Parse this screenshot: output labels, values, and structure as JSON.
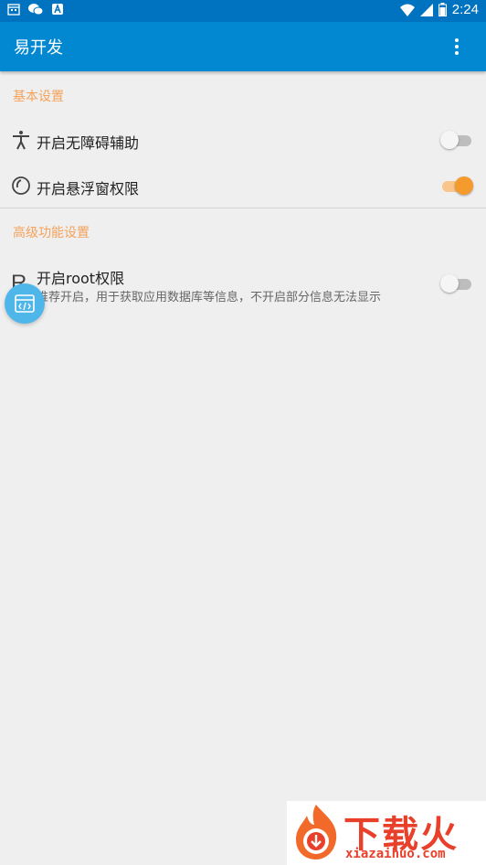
{
  "status_bar": {
    "time": "2:24",
    "left_icons": [
      "calendar-icon",
      "wechat-icon",
      "notification-a-icon"
    ],
    "right_icons": [
      "wifi-icon",
      "signal-icon",
      "battery-icon"
    ]
  },
  "app_bar": {
    "title": "易开发",
    "menu_icon": "more-vert-icon"
  },
  "sections": [
    {
      "header": "基本设置",
      "items": [
        {
          "title": "开启无障碍辅助",
          "icon": "accessibility-icon",
          "enabled": false
        },
        {
          "title": "开启悬浮窗权限",
          "icon": "floating-window-icon",
          "enabled": true
        }
      ]
    },
    {
      "header": "高级功能设置",
      "items": [
        {
          "title": "开启root权限",
          "subtitle": "推荐开启，用于获取应用数据库等信息，不开启部分信息无法显示",
          "icon": "root-icon",
          "icon_glyph": "R",
          "enabled": false
        }
      ]
    }
  ],
  "floating_button": {
    "icon": "code-window-icon"
  },
  "watermark": {
    "text": "下载火",
    "url": "xiazaihuo.com"
  },
  "colors": {
    "status_bar": "#0073c0",
    "app_bar": "#0288d1",
    "accent": "#f59a2c",
    "section_header": "#f5a25a",
    "background": "#efefef"
  }
}
